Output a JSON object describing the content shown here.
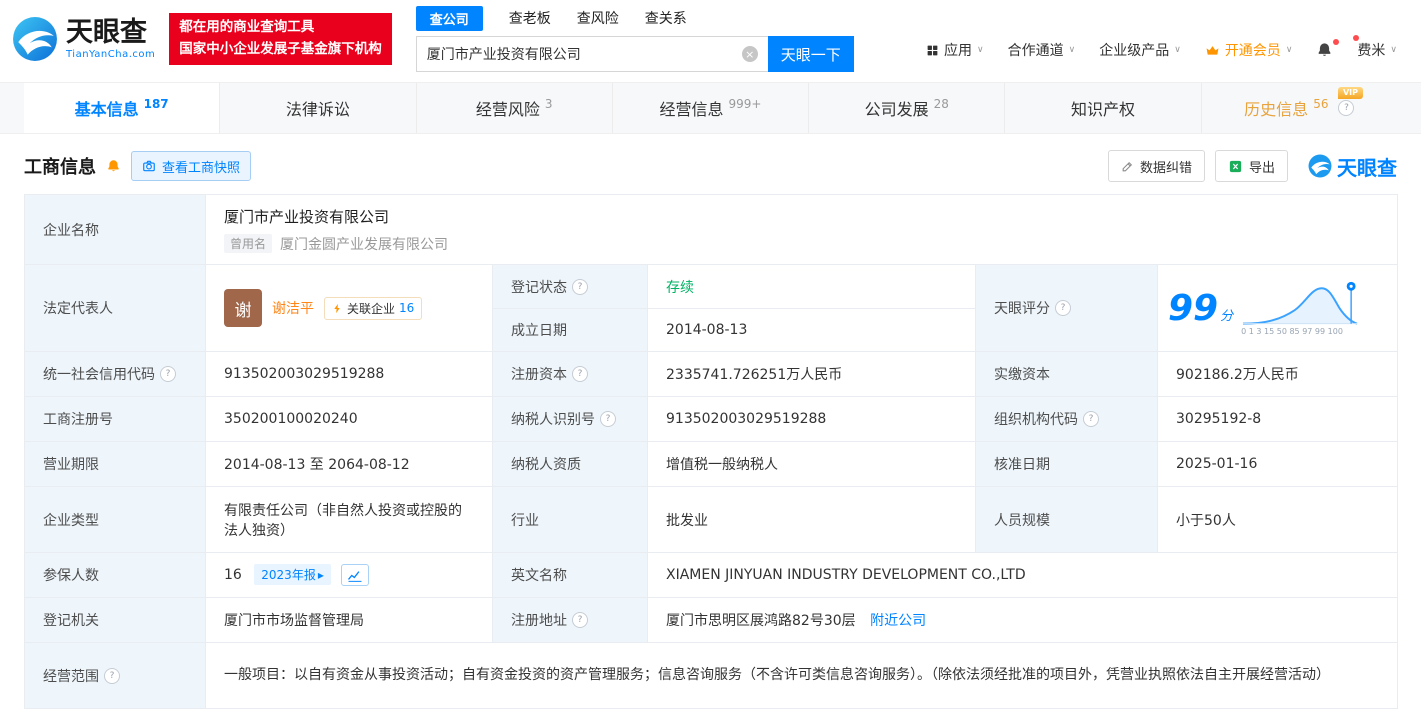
{
  "brand": {
    "logo_text": "天眼查",
    "logo_domain": "TianYanCha.com",
    "promo_line1": "都在用的商业查询工具",
    "promo_line2": "国家中小企业发展子基金旗下机构"
  },
  "icons": {
    "help": "?",
    "caret": "∨",
    "clear": "×",
    "arrow": "▸"
  },
  "search": {
    "tab_company": "查公司",
    "tab_boss": "查老板",
    "tab_risk": "查风险",
    "tab_relation": "查关系",
    "input_value": "厦门市产业投资有限公司",
    "button_label": "天眼一下"
  },
  "nav": {
    "apps": "应用",
    "cooperation": "合作通道",
    "enterprise": "企业级产品",
    "vip": "开通会员",
    "user": "费米"
  },
  "tabs": {
    "basic": {
      "label": "基本信息",
      "count": "187"
    },
    "legal": {
      "label": "法律诉讼"
    },
    "risk": {
      "label": "经营风险",
      "count": "3"
    },
    "operation": {
      "label": "经营信息",
      "count": "999+"
    },
    "development": {
      "label": "公司发展",
      "count": "28"
    },
    "ip": {
      "label": "知识产权"
    },
    "history": {
      "label": "历史信息",
      "count": "56",
      "vip_tag": "VIP"
    }
  },
  "section": {
    "title": "工商信息",
    "snapshot": "查看工商快照",
    "correction": "数据纠错",
    "export": "导出",
    "watermark": "天眼查"
  },
  "fields": {
    "company_name": {
      "label": "企业名称",
      "value": "厦门市产业投资有限公司"
    },
    "former_name": {
      "tag": "曾用名",
      "value": "厦门金圆产业发展有限公司"
    },
    "legal_rep": {
      "label": "法定代表人",
      "avatar": "谢",
      "name": "谢洁平",
      "related_label": "关联企业",
      "related_count": "16"
    },
    "reg_status": {
      "label": "登记状态",
      "value": "存续"
    },
    "est_date": {
      "label": "成立日期",
      "value": "2014-08-13"
    },
    "score": {
      "label": "天眼评分",
      "value": "99",
      "unit": "分",
      "axis": "0 1 3 15 50 85 97 99 100"
    },
    "credit_code": {
      "label": "统一社会信用代码",
      "value": "913502003029519288"
    },
    "reg_capital": {
      "label": "注册资本",
      "value": "2335741.726251万人民币"
    },
    "paid_capital": {
      "label": "实缴资本",
      "value": "902186.2万人民币"
    },
    "reg_no": {
      "label": "工商注册号",
      "value": "350200100020240"
    },
    "tax_id": {
      "label": "纳税人识别号",
      "value": "913502003029519288"
    },
    "org_code": {
      "label": "组织机构代码",
      "value": "30295192-8"
    },
    "term": {
      "label": "营业期限",
      "value": "2014-08-13 至 2064-08-12"
    },
    "tax_quality": {
      "label": "纳税人资质",
      "value": "增值税一般纳税人"
    },
    "approve_date": {
      "label": "核准日期",
      "value": "2025-01-16"
    },
    "type": {
      "label": "企业类型",
      "value": "有限责任公司（非自然人投资或控股的法人独资）"
    },
    "industry": {
      "label": "行业",
      "value": "批发业"
    },
    "staff": {
      "label": "人员规模",
      "value": "小于50人"
    },
    "insured": {
      "label": "参保人数",
      "value": "16",
      "badge": "2023年报"
    },
    "en_name": {
      "label": "英文名称",
      "value": "XIAMEN JINYUAN INDUSTRY DEVELOPMENT CO.,LTD"
    },
    "authority": {
      "label": "登记机关",
      "value": "厦门市市场监督管理局"
    },
    "address": {
      "label": "注册地址",
      "value": "厦门市思明区展鸿路82号30层",
      "link": "附近公司"
    },
    "scope": {
      "label": "经营范围",
      "value": "一般项目：以自有资金从事投资活动；自有资金投资的资产管理服务；信息咨询服务（不含许可类信息咨询服务）。（除依法须经批准的项目外，凭营业执照依法自主开展经营活动）"
    }
  },
  "colors": {
    "primary": "#0084ff",
    "orange": "#ff8619",
    "green": "#00b365",
    "red": "#e8001d",
    "gold": "#e8a33d"
  }
}
